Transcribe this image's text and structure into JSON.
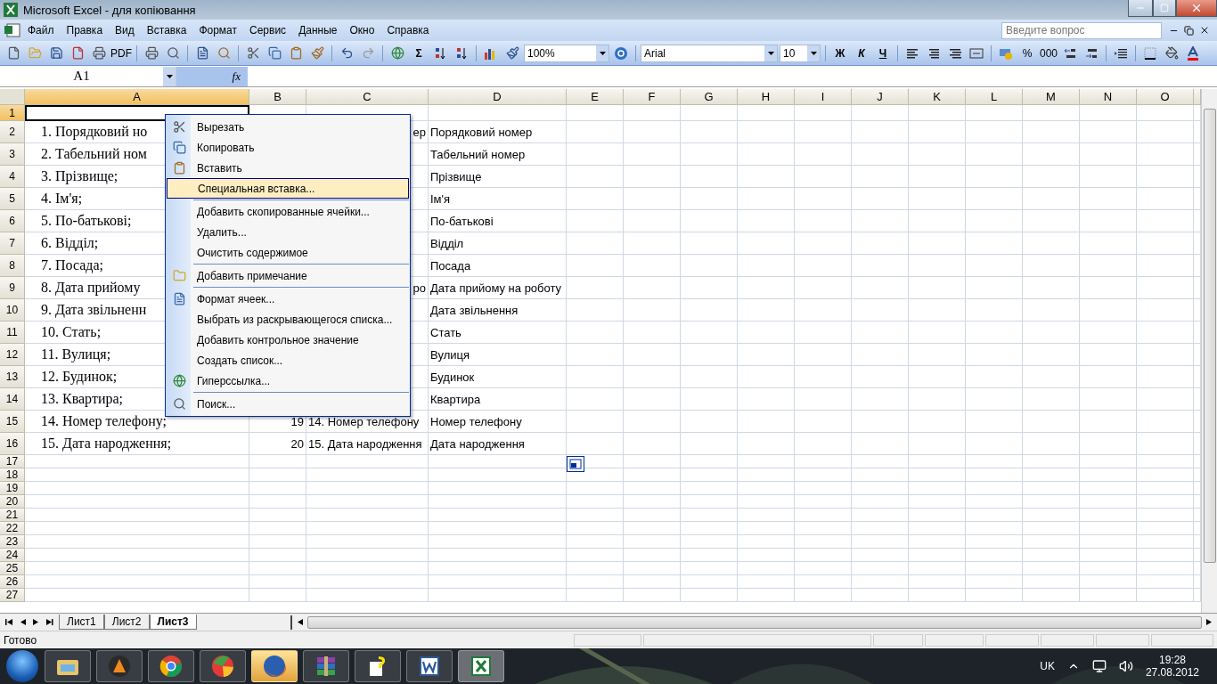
{
  "window": {
    "title": "Microsoft Excel - для копіювання"
  },
  "menu_bar": {
    "items": [
      {
        "label": "Файл"
      },
      {
        "label": "Правка"
      },
      {
        "label": "Вид"
      },
      {
        "label": "Вставка"
      },
      {
        "label": "Формат"
      },
      {
        "label": "Сервис"
      },
      {
        "label": "Данные"
      },
      {
        "label": "Окно"
      },
      {
        "label": "Справка"
      }
    ],
    "help_search": {
      "placeholder": "Введите вопрос"
    }
  },
  "toolbar": {
    "pdf_label": "PDF",
    "sum_label": "Σ",
    "zoom": "100%",
    "font": "Arial",
    "font_size": "10",
    "bold_label": "Ж",
    "italic_label": "К",
    "underline_label": "Ч",
    "percent_label": "%",
    "thousands_label": "000"
  },
  "formula_bar": {
    "name_box": "A1",
    "fx_label": "fx"
  },
  "columns": [
    {
      "label": "A",
      "selected": true
    },
    {
      "label": "B",
      "selected": false
    },
    {
      "label": "C",
      "selected": false
    },
    {
      "label": "D",
      "selected": false
    },
    {
      "label": "E",
      "selected": false
    },
    {
      "label": "F",
      "selected": false
    },
    {
      "label": "G",
      "selected": false
    },
    {
      "label": "H",
      "selected": false
    },
    {
      "label": "I",
      "selected": false
    },
    {
      "label": "J",
      "selected": false
    },
    {
      "label": "K",
      "selected": false
    },
    {
      "label": "L",
      "selected": false
    },
    {
      "label": "M",
      "selected": false
    },
    {
      "label": "N",
      "selected": false
    },
    {
      "label": "O",
      "selected": false
    }
  ],
  "rows": [
    {
      "number": "1",
      "selected": true
    },
    {
      "number": "2",
      "selected": false,
      "a": "1. Порядковий но",
      "c": "ер",
      "d": "Порядковий номер"
    },
    {
      "number": "3",
      "selected": false,
      "a": "2. Табельний ном",
      "d": "Табельний номер"
    },
    {
      "number": "4",
      "selected": false,
      "a": "3. Прізвище;",
      "d": "Прізвище"
    },
    {
      "number": "5",
      "selected": false,
      "a": "4. Ім'я;",
      "d": "Ім'я"
    },
    {
      "number": "6",
      "selected": false,
      "a": "5. По-батькові;",
      "d": "По-батькові"
    },
    {
      "number": "7",
      "selected": false,
      "a": "6. Відділ;",
      "d": "Відділ"
    },
    {
      "number": "8",
      "selected": false,
      "a": "7. Посада;",
      "d": "Посада"
    },
    {
      "number": "9",
      "selected": false,
      "a": "8. Дата прийому",
      "c": "ро",
      "d": "Дата прийому на роботу"
    },
    {
      "number": "10",
      "selected": false,
      "a": "9. Дата звільненн",
      "d": "Дата звільнення"
    },
    {
      "number": "11",
      "selected": false,
      "a": "10. Стать;",
      "d": "Стать"
    },
    {
      "number": "12",
      "selected": false,
      "a": "11. Вулиця;",
      "d": "Вулиця"
    },
    {
      "number": "13",
      "selected": false,
      "a": "12. Будинок;",
      "d": "Будинок"
    },
    {
      "number": "14",
      "selected": false,
      "a": "13. Квартира;",
      "d": "Квартира"
    },
    {
      "number": "15",
      "selected": false,
      "a": "14. Номер телефону;",
      "b": "19",
      "c": "14. Номер телефону",
      "d": "Номер телефону"
    },
    {
      "number": "16",
      "selected": false,
      "a": "15. Дата народження;",
      "b": "20",
      "c": "15. Дата народження",
      "d": "Дата народження"
    },
    {
      "number": "17",
      "selected": false
    },
    {
      "number": "18",
      "selected": false
    },
    {
      "number": "19",
      "selected": false
    },
    {
      "number": "20",
      "selected": false
    },
    {
      "number": "21",
      "selected": false
    },
    {
      "number": "22",
      "selected": false
    },
    {
      "number": "23",
      "selected": false
    },
    {
      "number": "24",
      "selected": false
    },
    {
      "number": "25",
      "selected": false
    },
    {
      "number": "26",
      "selected": false
    },
    {
      "number": "27",
      "selected": false
    }
  ],
  "context_menu": {
    "items": [
      {
        "label": "Вырезать",
        "selected": false,
        "separator_before": false
      },
      {
        "label": "Копировать",
        "selected": false,
        "separator_before": false
      },
      {
        "label": "Вставить",
        "selected": false,
        "separator_before": false
      },
      {
        "label": "Специальная вставка...",
        "selected": true,
        "separator_before": false
      },
      {
        "label": "Добавить скопированные ячейки...",
        "selected": false,
        "separator_before": true
      },
      {
        "label": "Удалить...",
        "selected": false,
        "separator_before": false
      },
      {
        "label": "Очистить содержимое",
        "selected": false,
        "separator_before": false
      },
      {
        "label": "Добавить примечание",
        "selected": false,
        "separator_before": true
      },
      {
        "label": "Формат ячеек...",
        "selected": false,
        "separator_before": true
      },
      {
        "label": "Выбрать из раскрывающегося списка...",
        "selected": false,
        "separator_before": false
      },
      {
        "label": "Добавить контрольное значение",
        "selected": false,
        "separator_before": false
      },
      {
        "label": "Создать список...",
        "selected": false,
        "separator_before": false
      },
      {
        "label": "Гиперссылка...",
        "selected": false,
        "separator_before": false
      },
      {
        "label": "Поиск...",
        "selected": false,
        "separator_before": true
      }
    ]
  },
  "sheet_tabs": [
    {
      "label": "Лист1",
      "selected": false
    },
    {
      "label": "Лист2",
      "selected": false
    },
    {
      "label": "Лист3",
      "selected": true
    }
  ],
  "status_bar": {
    "text": "Готово"
  },
  "taskbar": {
    "apps": [
      {
        "highlighted": false,
        "active": false
      },
      {
        "highlighted": false,
        "active": false
      },
      {
        "highlighted": false,
        "active": false
      },
      {
        "highlighted": false,
        "active": false
      },
      {
        "highlighted": true,
        "active": false
      },
      {
        "highlighted": false,
        "active": false
      },
      {
        "highlighted": false,
        "active": false
      },
      {
        "highlighted": false,
        "active": false
      },
      {
        "highlighted": false,
        "active": true
      }
    ],
    "language": "UK",
    "time": "19:28",
    "date": "27.08.2012"
  }
}
